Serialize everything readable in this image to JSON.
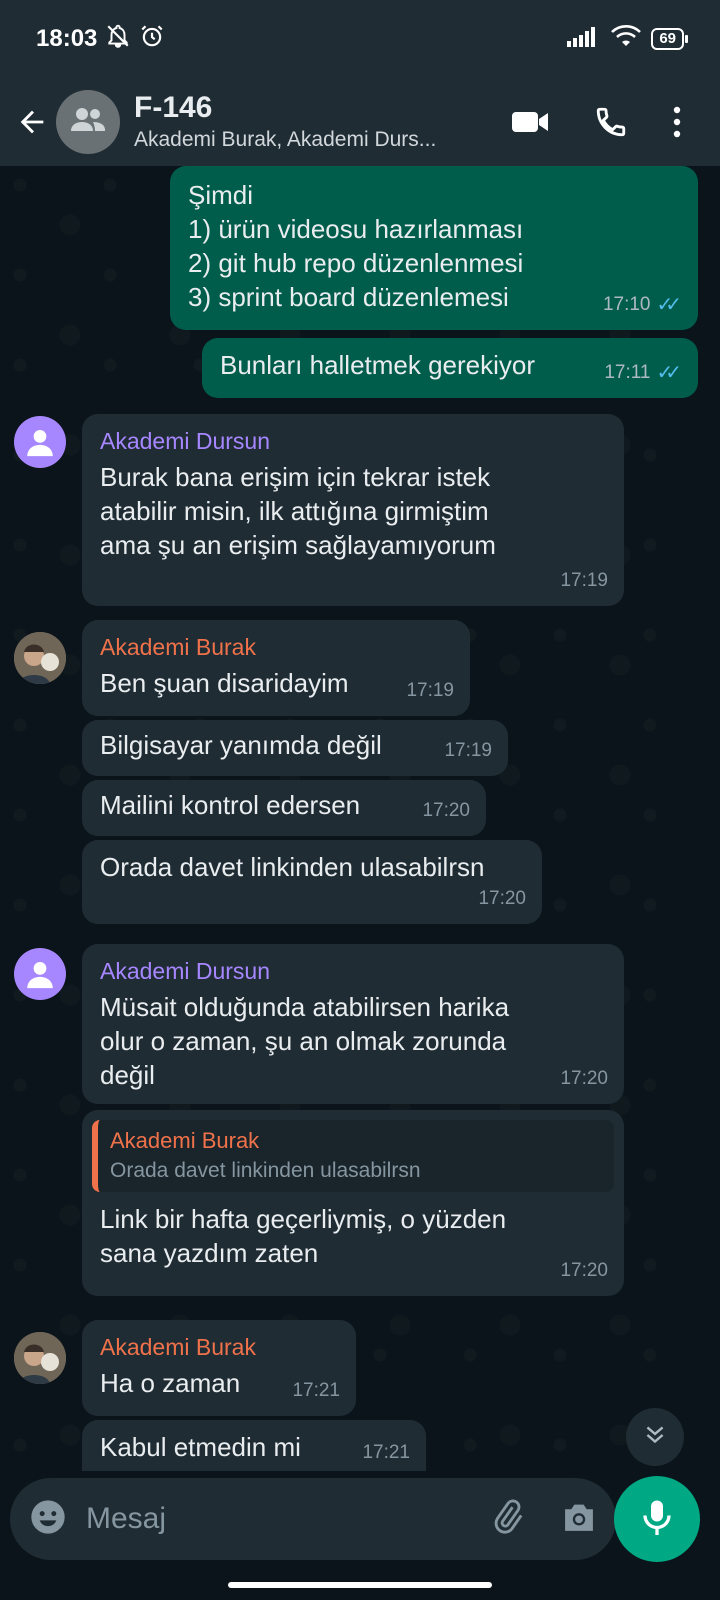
{
  "status": {
    "time": "18:03",
    "battery": "69"
  },
  "header": {
    "title": "F-146",
    "subtitle": "Akademi Burak, Akademi Durs..."
  },
  "messages": {
    "m1": {
      "lines": [
        "Şimdi",
        "1) ürün videosu hazırlanması",
        "2) git hub repo düzenlenmesi",
        "3) sprint board düzenlemesi"
      ],
      "time": "17:10"
    },
    "m2": {
      "text": "Bunları halletmek gerekiyor",
      "time": "17:11"
    },
    "m3": {
      "sender": "Akademi Dursun",
      "lines": [
        "Burak bana erişim için tekrar istek",
        "atabilir misin, ilk attığına girmiştim",
        "ama şu an erişim sağlayamıyorum"
      ],
      "time": "17:19"
    },
    "m4": {
      "sender": "Akademi Burak",
      "text": "Ben şuan disaridayim",
      "time": "17:19"
    },
    "m5": {
      "text": "Bilgisayar yanımda değil",
      "time": "17:19"
    },
    "m6": {
      "text": "Mailini kontrol edersen",
      "time": "17:20"
    },
    "m7": {
      "text": "Orada davet linkinden ulasabilrsn",
      "time": "17:20"
    },
    "m8": {
      "sender": "Akademi Dursun",
      "lines": [
        "Müsait olduğunda atabilirsen harika",
        "olur o zaman, şu an olmak zorunda",
        "değil"
      ],
      "time": "17:20"
    },
    "m9": {
      "quote_sender": "Akademi Burak",
      "quote_text": "Orada davet linkinden ulasabilrsn",
      "lines": [
        "Link bir hafta geçerliymiş, o yüzden",
        "sana yazdım zaten"
      ],
      "time": "17:20"
    },
    "m10": {
      "sender": "Akademi Burak",
      "text": "Ha o zaman",
      "time": "17:21"
    },
    "m11": {
      "text": "Kabul etmedin mi",
      "time": "17:21"
    }
  },
  "composer": {
    "placeholder": "Mesaj"
  },
  "icons": {
    "back": "arrow-left-icon",
    "group": "group-icon",
    "video": "video-call-icon",
    "call": "phone-icon",
    "menu": "more-vert-icon",
    "emoji": "emoji-icon",
    "attach": "attach-icon",
    "camera": "camera-icon",
    "mic": "mic-icon",
    "scroll": "double-chevron-down-icon"
  },
  "colors": {
    "outgoing": "#005c4b",
    "incoming": "#1f2c34",
    "accent": "#00a884",
    "dursun": "#a787ff",
    "burak": "#f0724a"
  }
}
